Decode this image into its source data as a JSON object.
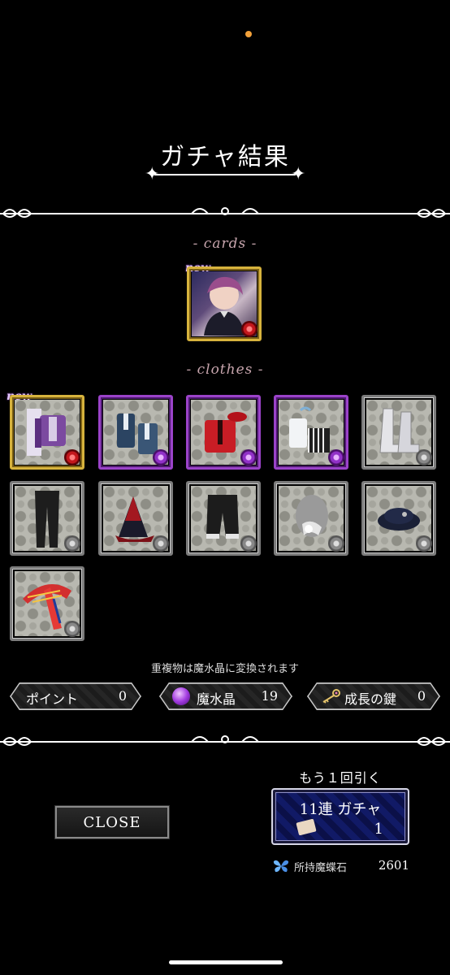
{
  "page": {
    "title": "ガチャ結果",
    "sections": {
      "cards_label": "- cards -",
      "clothes_label": "- clothes -"
    },
    "new_badge": "new",
    "notice": "重複物は魔水晶に変換されます"
  },
  "cards": [
    {
      "name": "card-portrait",
      "rarity": "gold",
      "is_new": true
    }
  ],
  "clothes": [
    {
      "item": "jacket-purple",
      "frame": "gold",
      "rose": "red",
      "is_new": true
    },
    {
      "item": "jacket-blue",
      "frame": "purple",
      "rose": "purple",
      "is_new": false
    },
    {
      "item": "jacket-red",
      "frame": "purple",
      "rose": "purple",
      "is_new": false
    },
    {
      "item": "outfit-white",
      "frame": "purple",
      "rose": "purple",
      "is_new": false
    },
    {
      "item": "boots-white",
      "frame": "gray",
      "rose": "gray",
      "is_new": false
    },
    {
      "item": "pants-black",
      "frame": "gray",
      "rose": "gray",
      "is_new": false
    },
    {
      "item": "cape-red",
      "frame": "gray",
      "rose": "gray",
      "is_new": false
    },
    {
      "item": "shorts-black",
      "frame": "gray",
      "rose": "gray",
      "is_new": false
    },
    {
      "item": "accessory-mannequin",
      "frame": "gray",
      "rose": "gray",
      "is_new": false
    },
    {
      "item": "hat-navy",
      "frame": "gray",
      "rose": "gray",
      "is_new": false
    },
    {
      "item": "scarf-red",
      "frame": "gray",
      "rose": "gray",
      "is_new": false
    }
  ],
  "counters": {
    "points": {
      "label": "ポイント",
      "value": "0"
    },
    "crystal": {
      "label": "魔水晶",
      "value": "19",
      "icon": "crystal-icon"
    },
    "key": {
      "label": "成長の鍵",
      "value": "0",
      "icon": "key-icon"
    }
  },
  "actions": {
    "close_label": "CLOSE",
    "again_label": "もう１回引く",
    "gacha_name": "11連 ガチャ",
    "gacha_cost": "1",
    "owned_label": "所持魔蝶石",
    "owned_value": "2601"
  },
  "colors": {
    "accent_orange": "#f2a13a",
    "frame_gold": "#d7b33d",
    "frame_purple": "#9b43c9",
    "frame_gray": "#7c7c7c",
    "gacha_blue": "#111a66"
  }
}
